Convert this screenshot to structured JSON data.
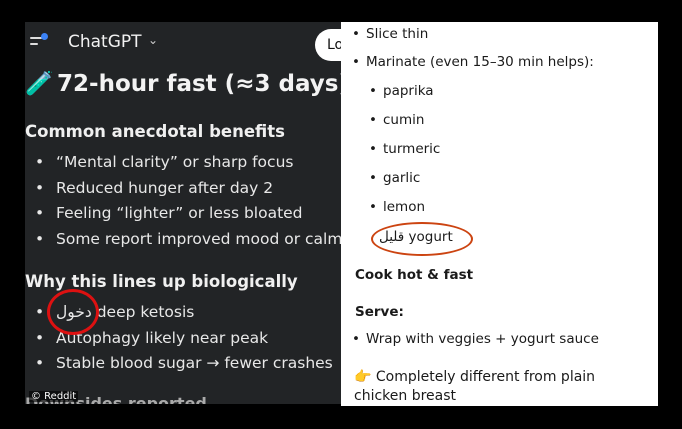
{
  "header": {
    "app_name": "ChatGPT",
    "chevron_icon": "chevron-down-icon",
    "login_label": "Lo"
  },
  "left": {
    "title_icon": "🧪",
    "title": "72-hour fast (≈3 days)",
    "section1": "Common anecdotal benefits",
    "benefits": [
      "“Mental clarity” or sharp focus",
      "Reduced hunger after day 2",
      "Feeling “lighter” or less bloated",
      "Some report improved mood or calmness"
    ],
    "section2": "Why this lines up biologically",
    "reasons": [
      "دخول deep ketosis",
      "Autophagy likely near peak",
      "Stable blood sugar → fewer crashes"
    ],
    "cutoff_heading": "Downsides reported",
    "watermark": "© Reddit"
  },
  "right": {
    "bullet1": "Slice thin",
    "bullet2": "Marinate (even 15–30 min helps):",
    "spices": [
      "paprika",
      "cumin",
      "turmeric",
      "garlic",
      "lemon"
    ],
    "yogurt": "قليل yogurt",
    "cook": "Cook hot & fast",
    "serve_heading": "Serve:",
    "serve_item": "Wrap with veggies + yogurt sauce",
    "point_icon": "👉",
    "closing": "Completely different from plain chicken breast"
  },
  "colors": {
    "left_bg": "#222426",
    "annotation_red": "#d11111",
    "accent_dot": "#3b82f6"
  }
}
